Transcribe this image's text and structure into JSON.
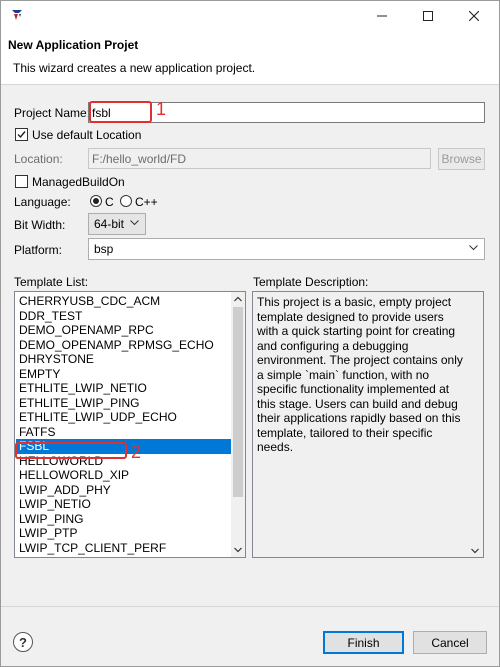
{
  "window": {
    "minimize_icon": "minimize-icon",
    "maximize_icon": "maximize-icon",
    "close_icon": "close-icon"
  },
  "header": {
    "title": "New Application Projet",
    "description": "This wizard creates a new application project."
  },
  "form": {
    "project_name_label": "Project Name:",
    "project_name_value": "fsbl",
    "use_default_location_label": "Use default Location",
    "use_default_location_checked": true,
    "location_label": "Location:",
    "location_value": "F:/hello_world/FD",
    "browse_label": "Browse",
    "managed_build_label": "ManagedBuildOn",
    "managed_build_checked": false,
    "language_label": "Language:",
    "language_options": [
      "C",
      "C++"
    ],
    "language_selected": "C",
    "bit_width_label": "Bit Width:",
    "bit_width_value": "64-bit",
    "platform_label": "Platform:",
    "platform_value": "bsp"
  },
  "templates": {
    "list_label": "Template List:",
    "description_label": "Template Description:",
    "items": [
      "CHERRYUSB_CDC_ACM",
      "DDR_TEST",
      "DEMO_OPENAMP_RPC",
      "DEMO_OPENAMP_RPMSG_ECHO",
      "DHRYSTONE",
      "EMPTY",
      "ETHLITE_LWIP_NETIO",
      "ETHLITE_LWIP_PING",
      "ETHLITE_LWIP_UDP_ECHO",
      "FATFS",
      "FSBL",
      "HELLOWORLD",
      "HELLOWORLD_XIP",
      "LWIP_ADD_PHY",
      "LWIP_NETIO",
      "LWIP_PING",
      "LWIP_PTP",
      "LWIP_TCP_CLIENT_PERF"
    ],
    "selected": "FSBL",
    "description": "This project is a basic, empty project template designed to provide users with a quick starting point for creating and configuring a debugging environment. The project contains only a simple `main` function, with no specific functionality implemented at this stage. Users can build and debug their applications rapidly based on this template, tailored to their specific needs."
  },
  "annotations": {
    "first": "1",
    "second": "2",
    "color": "#e03030"
  },
  "footer": {
    "help_label": "?",
    "finish_label": "Finish",
    "cancel_label": "Cancel"
  },
  "colors": {
    "selection": "#0078d7",
    "window_bg": "#f0f0f0"
  }
}
